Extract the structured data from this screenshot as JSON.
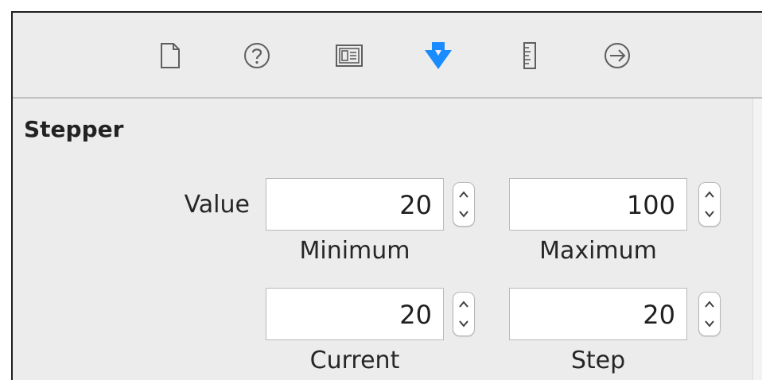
{
  "toolbar": {
    "icons": [
      {
        "name": "file-inspector-icon"
      },
      {
        "name": "quick-help-icon"
      },
      {
        "name": "identity-inspector-icon"
      },
      {
        "name": "attributes-inspector-icon",
        "selected": true
      },
      {
        "name": "size-inspector-icon"
      },
      {
        "name": "connections-inspector-icon"
      }
    ],
    "accent_color": "#1a8cff",
    "icon_color": "#6b6b6b"
  },
  "section": {
    "title": "Stepper"
  },
  "value_group": {
    "label": "Value",
    "minimum": {
      "value": "20",
      "caption": "Minimum"
    },
    "maximum": {
      "value": "100",
      "caption": "Maximum"
    },
    "current": {
      "value": "20",
      "caption": "Current"
    },
    "step": {
      "value": "20",
      "caption": "Step"
    }
  }
}
